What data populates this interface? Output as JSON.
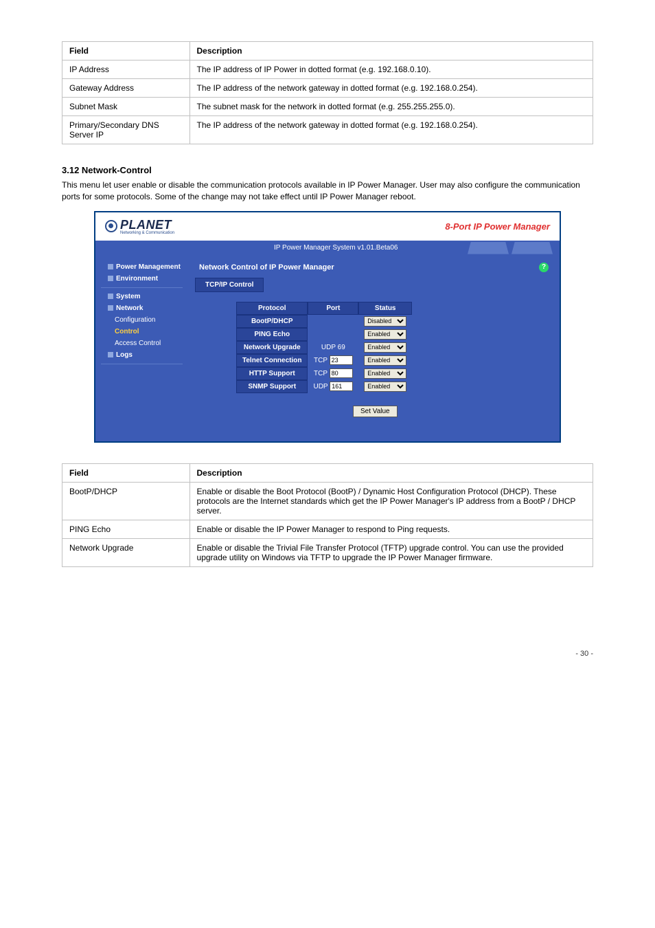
{
  "table1": {
    "header_field": "Field",
    "header_desc": "Description",
    "rows": [
      {
        "field": "IP Address",
        "desc": "The IP address of IP Power in dotted format (e.g. 192.168.0.10)."
      },
      {
        "field": "Gateway Address",
        "desc": "The IP address of the network gateway in dotted format (e.g. 192.168.0.254)."
      },
      {
        "field": "Subnet Mask",
        "desc": "The subnet mask for the network in dotted format (e.g. 255.255.255.0)."
      },
      {
        "field": "Primary/Secondary DNS Server IP",
        "desc": "The IP address of the network gateway in dotted format (e.g. 192.168.0.254)."
      }
    ]
  },
  "section": {
    "title": "3.12 Network-Control",
    "desc": "This menu let user enable or disable the communication protocols available in IP Power Manager. User may also configure the communication ports for some protocols. Some of the change may not take effect until IP Power Manager reboot."
  },
  "shot": {
    "logo_text": "PLANET",
    "logo_sub": "Networking & Communication",
    "header_right": "8-Port IP Power Manager",
    "version": "IP Power Manager System v1.01.Beta06",
    "sidebar": {
      "power_mgmt": "Power Management",
      "environment": "Environment",
      "system": "System",
      "network": "Network",
      "configuration": "Configuration",
      "control": "Control",
      "access_control": "Access Control",
      "logs": "Logs"
    },
    "panel_title": "Network Control of IP Power Manager",
    "subtab": "TCP/IP Control",
    "proto": {
      "col_protocol": "Protocol",
      "col_port": "Port",
      "col_status": "Status",
      "rows": [
        {
          "name": "BootP/DHCP",
          "port_label": "",
          "port_val": "",
          "status": "Disabled"
        },
        {
          "name": "PING Echo",
          "port_label": "",
          "port_val": "",
          "status": "Enabled"
        },
        {
          "name": "Network Upgrade",
          "port_label": "UDP 69",
          "port_val": "",
          "status": "Enabled"
        },
        {
          "name": "Telnet Connection",
          "port_label": "TCP",
          "port_val": "23",
          "status": "Enabled"
        },
        {
          "name": "HTTP Support",
          "port_label": "TCP",
          "port_val": "80",
          "status": "Enabled"
        },
        {
          "name": "SNMP Support",
          "port_label": "UDP",
          "port_val": "161",
          "status": "Enabled"
        }
      ]
    },
    "set_value": "Set Value"
  },
  "table2": {
    "header_field": "Field",
    "header_desc": "Description",
    "rows": [
      {
        "field": "BootP/DHCP",
        "desc": "Enable or disable the Boot Protocol (BootP) / Dynamic Host Configuration Protocol (DHCP). These protocols are the Internet standards which get the IP Power Manager's IP address from a BootP / DHCP server."
      },
      {
        "field": "PING Echo",
        "desc": "Enable or disable the IP Power Manager to respond to Ping requests."
      },
      {
        "field": "Network Upgrade",
        "desc": "Enable or disable the Trivial File Transfer Protocol (TFTP) upgrade control. You can use the provided upgrade utility on Windows via TFTP to upgrade the IP Power Manager firmware."
      }
    ]
  },
  "footer": "- 30 -"
}
